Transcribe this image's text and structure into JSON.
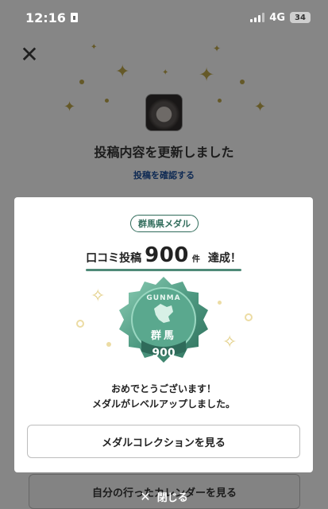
{
  "status_bar": {
    "time": "12:16",
    "network": "4G",
    "battery": "34"
  },
  "background": {
    "title": "投稿内容を更新しました",
    "link": "投稿を確認する",
    "calendar_button": "自分の行ったカレンダーを見る"
  },
  "modal": {
    "badge": "群馬県メダル",
    "achievement": {
      "prefix": "口コミ投稿",
      "count": "900",
      "unit": "件",
      "suffix": "達成！"
    },
    "medal": {
      "top_text": "GUNMA",
      "kanji": "群馬",
      "number": "900",
      "color": "#4f9a82"
    },
    "congrats_line1": "おめでとうございます！",
    "congrats_line2": "メダルがレベルアップしました。",
    "collection_button": "メダルコレクションを見る"
  },
  "bottom_close": {
    "label": "閉じる"
  },
  "icons": [
    "close-icon",
    "sim-icon",
    "signal-icon",
    "battery-icon",
    "sparkle-icon"
  ]
}
